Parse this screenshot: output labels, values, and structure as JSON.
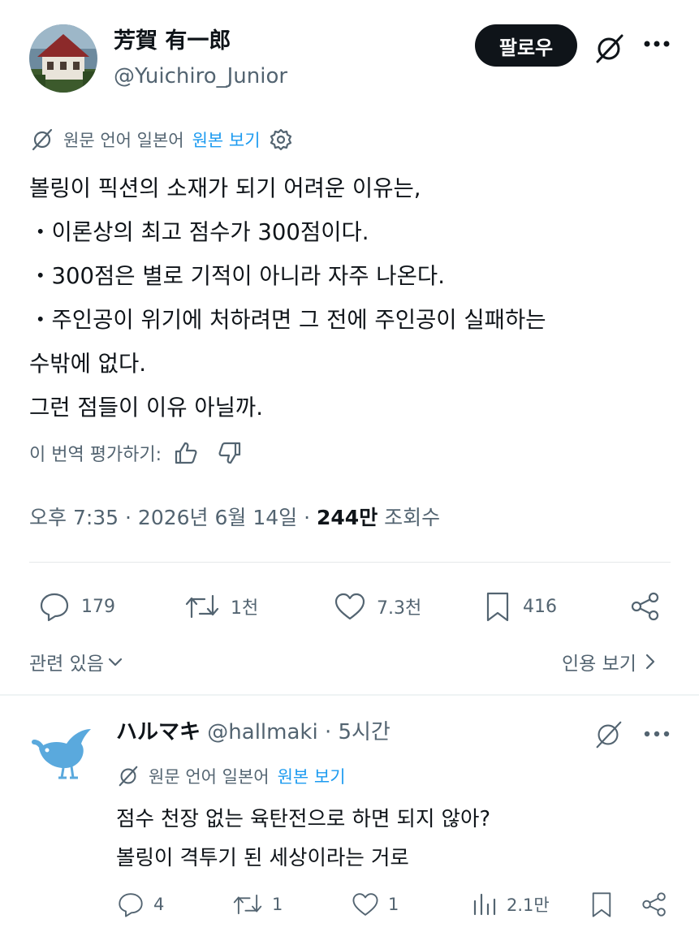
{
  "author": {
    "display_name": "芳賀 有一郎",
    "handle": "@Yuichiro_Junior"
  },
  "follow_button": "팔로우",
  "translation": {
    "source_text": "원문 언어 일본어",
    "view_original": "원본 보기"
  },
  "tweet": {
    "lines": [
      "볼링이 픽션의 소재가 되기 어려운 이유는,",
      "・이론상의 최고 점수가 300점이다.",
      "・300점은 별로 기적이 아니라 자주 나온다.",
      "・주인공이 위기에 처하려면 그 전에 주인공이 실패하는",
      "수밖에 없다.",
      "그런 점들이 이유 아닐까."
    ]
  },
  "rate_translation": "이 번역 평가하기:",
  "meta": {
    "time_date": "오후 7:35 · 2026년 6월 14일 · ",
    "views_count": "244만",
    "views_label": " 조회수"
  },
  "actions": {
    "replies": "179",
    "retweets": "1천",
    "likes": "7.3천",
    "bookmarks": "416"
  },
  "related_label": "관련 있음",
  "quote_label": "인용 보기",
  "reply": {
    "display_name": "ハルマキ",
    "handle_time": " @hallmaki · 5시간",
    "translation_source": "원문 언어 일본어",
    "view_original": "원본 보기",
    "lines": [
      "점수 천장 없는 육탄전으로 하면 되지 않아?",
      "볼링이 격투기 된 세상이라는 거로"
    ],
    "actions": {
      "replies": "4",
      "retweets": "1",
      "likes": "1",
      "views": "2.1만"
    }
  },
  "colors": {
    "text": "#0f1419",
    "muted": "#536471",
    "link": "#1d9bf0",
    "button_bg": "#0f1419"
  }
}
